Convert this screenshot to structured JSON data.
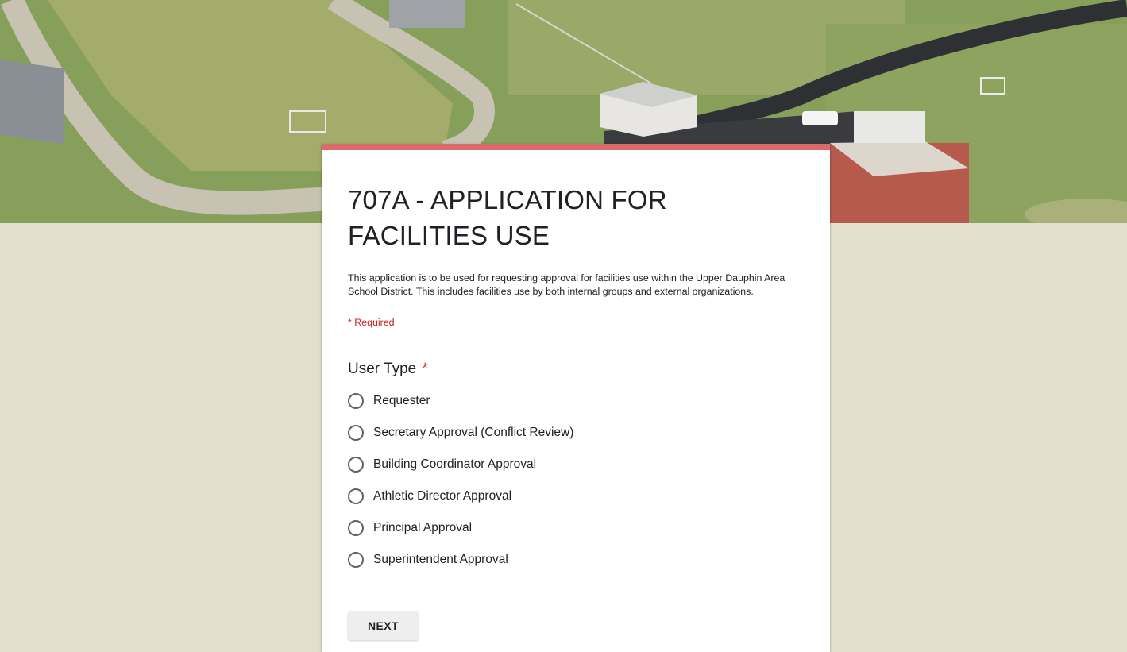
{
  "header": {
    "image_alt": "Aerial view of school athletic fields"
  },
  "form": {
    "title": "707A - APPLICATION FOR FACILITIES USE",
    "description": "This application is to be used for requesting approval for facilities use within the Upper Dauphin Area School District.  This includes facilities use by both internal groups and external organizations.",
    "required_note": "* Required",
    "accent_color": "#db6b6b",
    "background_color": "#e3dfcd"
  },
  "question": {
    "title": "User Type",
    "required_marker": "*",
    "options": [
      {
        "label": "Requester",
        "selected": false
      },
      {
        "label": "Secretary Approval (Conflict Review)",
        "selected": false
      },
      {
        "label": "Building Coordinator Approval",
        "selected": false
      },
      {
        "label": "Athletic Director Approval",
        "selected": false
      },
      {
        "label": "Principal Approval",
        "selected": false
      },
      {
        "label": "Superintendent Approval",
        "selected": false
      }
    ]
  },
  "navigation": {
    "next_label": "NEXT"
  }
}
